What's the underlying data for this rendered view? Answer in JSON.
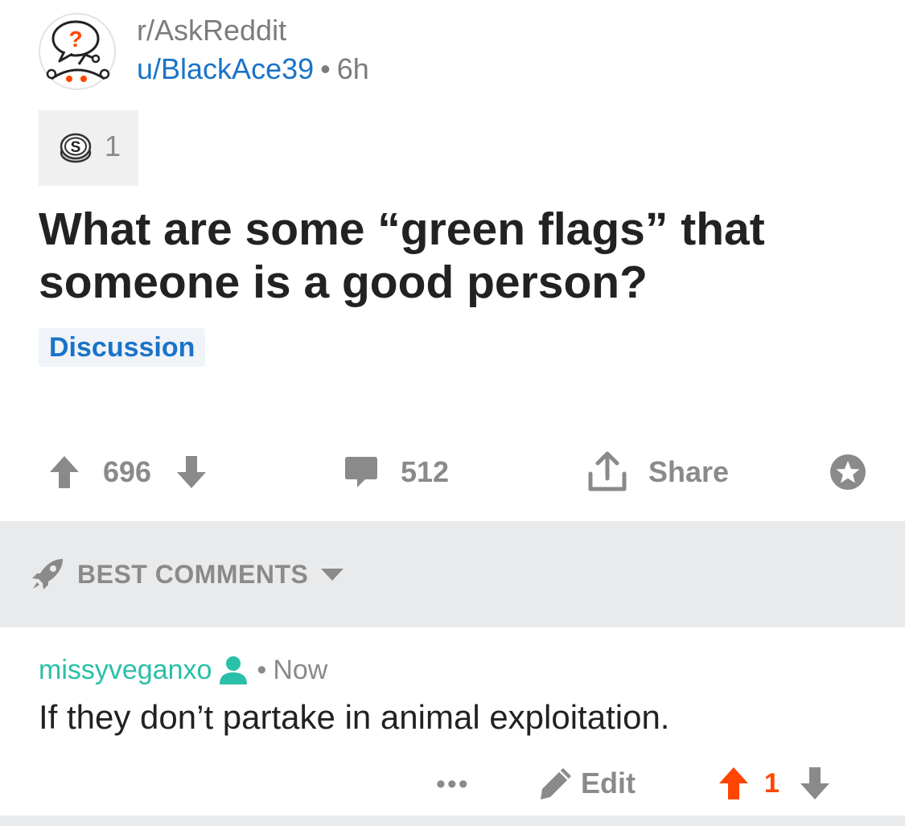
{
  "post": {
    "subreddit": "r/AskReddit",
    "author": "u/BlackAce39",
    "separator": "•",
    "age": "6h",
    "award_count": "1",
    "title": "What are some “green flags” that someone is a good person?",
    "flair": "Discussion",
    "score": "696",
    "comment_count": "512",
    "share_label": "Share"
  },
  "sort": {
    "label": "BEST COMMENTS"
  },
  "comment": {
    "author": "missyveganxo",
    "separator": "•",
    "time": "Now",
    "body": "If they don’t partake in animal exploitation.",
    "more_label": "•••",
    "edit_label": "Edit",
    "score": "1"
  },
  "colors": {
    "link_blue": "#1a73c8",
    "author_teal": "#29bfa8",
    "upvoted_orange": "#ff4500",
    "muted_gray": "#8a8a8a",
    "sort_bar_bg": "#e9eaeb"
  },
  "icons": {
    "subreddit_avatar": "askreddit-snoo-icon",
    "award": "silver-coin-icon",
    "upvote": "arrow-up-icon",
    "downvote": "arrow-down-icon",
    "comments": "speech-bubble-icon",
    "share": "share-upload-icon",
    "save": "star-icon",
    "sort": "rocket-icon",
    "sort_caret": "caret-down-icon",
    "commenter": "person-icon",
    "edit": "pencil-icon"
  }
}
